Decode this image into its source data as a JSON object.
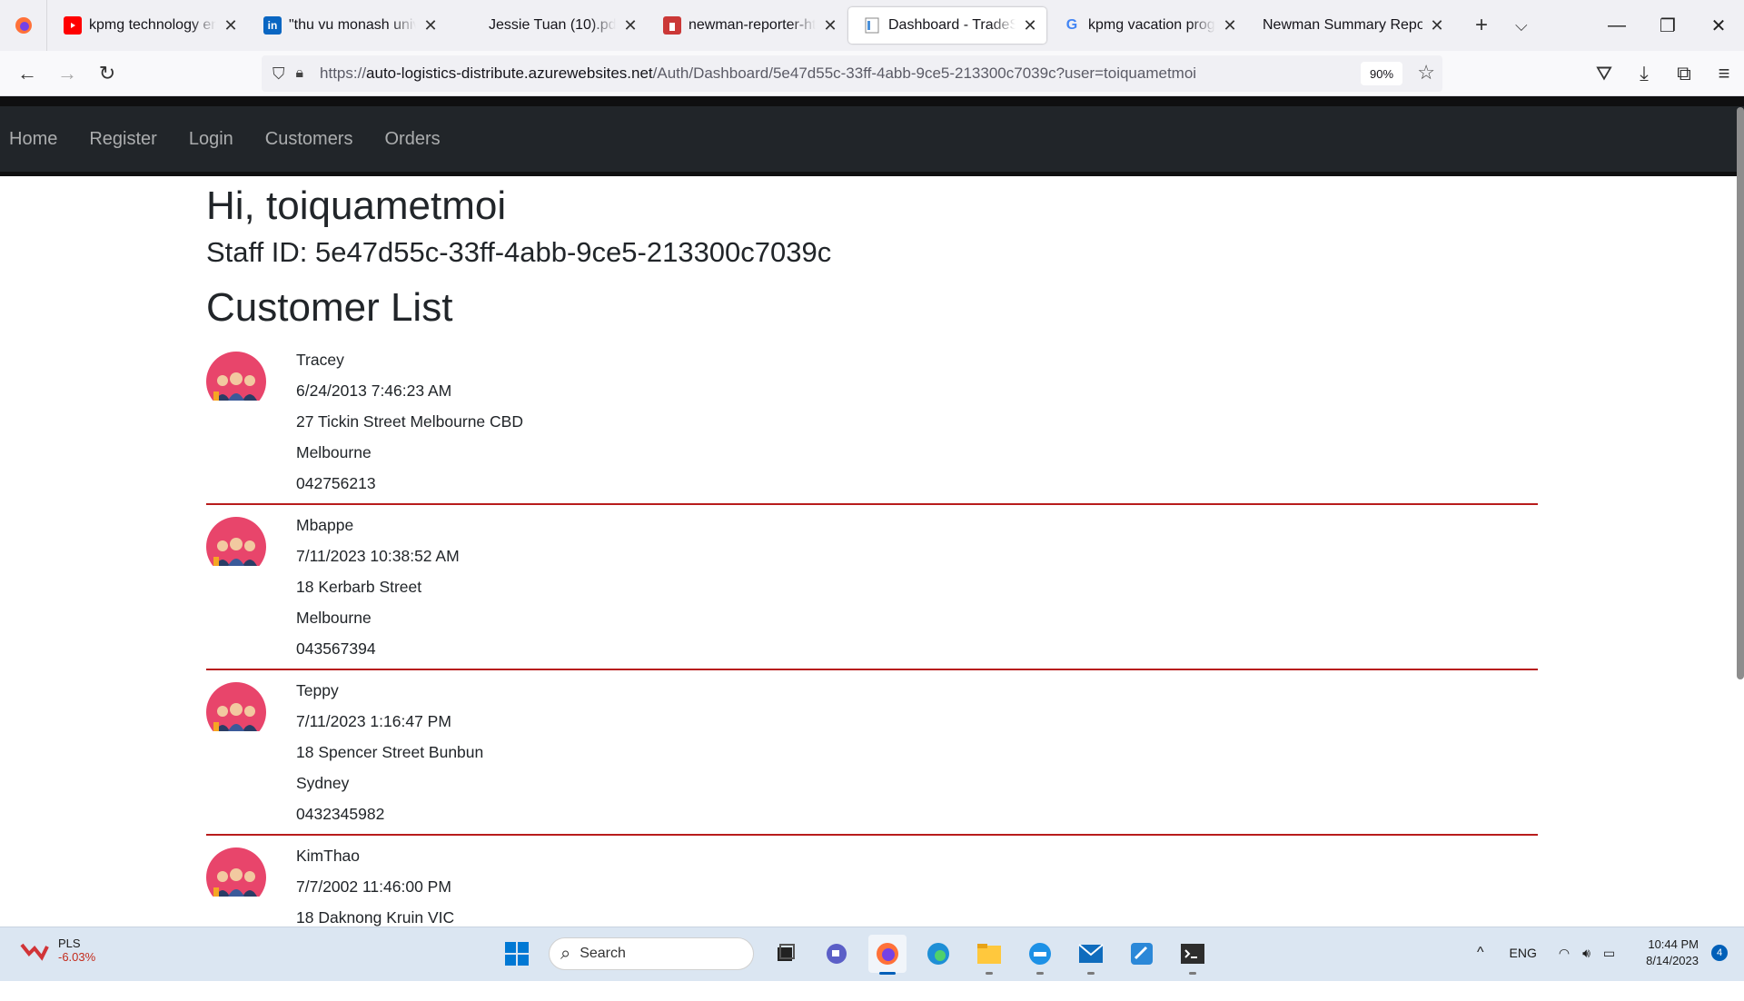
{
  "browser": {
    "tabs": [
      {
        "title": "kpmg technology eng",
        "favicon": "youtube-icon"
      },
      {
        "title": "\"thu vu monash univer",
        "favicon": "linkedin-icon"
      },
      {
        "title": "Jessie Tuan (10).pdf",
        "favicon": "pdf-icon"
      },
      {
        "title": "newman-reporter-htm",
        "favicon": "npm-icon"
      },
      {
        "title": "Dashboard - TradeSyst",
        "favicon": "page-icon",
        "active": true
      },
      {
        "title": "kpmg vacation progra",
        "favicon": "google-icon"
      },
      {
        "title": "Newman Summary Report",
        "favicon": "blank-icon"
      }
    ],
    "url_prefix": "https://",
    "url_host": "auto-logistics-distribute.azurewebsites.net",
    "url_path": "/Auth/Dashboard/5e47d55c-33ff-4abb-9ce5-213300c7039c?user=toiquametmoi",
    "zoom": "90%"
  },
  "site_nav": {
    "links": [
      "Home",
      "Register",
      "Login",
      "Customers",
      "Orders"
    ]
  },
  "page": {
    "greeting": "Hi, toiquametmoi",
    "staff_id": "Staff ID: 5e47d55c-33ff-4abb-9ce5-213300c7039c",
    "list_title": "Customer List"
  },
  "customers": [
    {
      "name": "Tracey",
      "date": "6/24/2013 7:46:23 AM",
      "address": "27 Tickin Street Melbourne CBD",
      "city": "Melbourne",
      "phone": "042756213"
    },
    {
      "name": "Mbappe",
      "date": "7/11/2023 10:38:52 AM",
      "address": "18 Kerbarb Street",
      "city": "Melbourne",
      "phone": "043567394"
    },
    {
      "name": "Teppy",
      "date": "7/11/2023 1:16:47 PM",
      "address": "18 Spencer Street Bunbun",
      "city": "Sydney",
      "phone": "0432345982"
    },
    {
      "name": "KimThao",
      "date": "7/7/2002 11:46:00 PM",
      "address": "18 Daknong Kruin VIC",
      "city": "",
      "phone": ""
    }
  ],
  "taskbar": {
    "stock_symbol": "PLS",
    "stock_change": "-6.03%",
    "search_label": "Search",
    "lang": "ENG",
    "time": "10:44 PM",
    "date": "8/14/2023",
    "notifications": "4"
  },
  "colors": {
    "navbar_bg": "#212529",
    "divider": "#b81c1c",
    "avatar": "#e8456b"
  }
}
